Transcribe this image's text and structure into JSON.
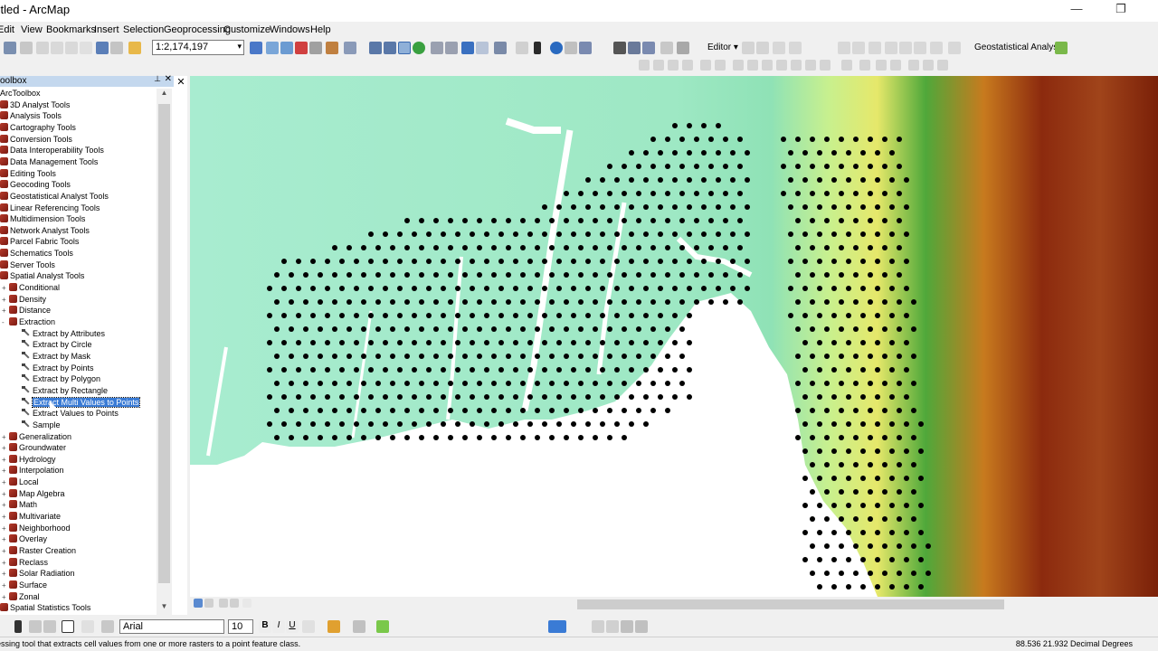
{
  "window": {
    "title": "titled - ArcMap",
    "minimize_glyph": "—",
    "restore_glyph": "❐"
  },
  "menu": [
    "Edit",
    "View",
    "Bookmarks",
    "Insert",
    "Selection",
    "Geoprocessing",
    "Customize",
    "Windows",
    "Help"
  ],
  "toolbar": {
    "scale": "1:2,174,197",
    "editor_label": "Editor ▾",
    "geostat_label": "Geostatistical Analyst ▾"
  },
  "toolbox": {
    "header": "oolbox",
    "root": "ArcToolbox",
    "items": [
      {
        "label": "3D Analyst Tools",
        "level": 0,
        "kind": "box"
      },
      {
        "label": "Analysis Tools",
        "level": 0,
        "kind": "box"
      },
      {
        "label": "Cartography Tools",
        "level": 0,
        "kind": "box"
      },
      {
        "label": "Conversion Tools",
        "level": 0,
        "kind": "box"
      },
      {
        "label": "Data Interoperability Tools",
        "level": 0,
        "kind": "box"
      },
      {
        "label": "Data Management Tools",
        "level": 0,
        "kind": "box"
      },
      {
        "label": "Editing Tools",
        "level": 0,
        "kind": "box"
      },
      {
        "label": "Geocoding Tools",
        "level": 0,
        "kind": "box"
      },
      {
        "label": "Geostatistical Analyst Tools",
        "level": 0,
        "kind": "box"
      },
      {
        "label": "Linear Referencing Tools",
        "level": 0,
        "kind": "box"
      },
      {
        "label": "Multidimension Tools",
        "level": 0,
        "kind": "box"
      },
      {
        "label": "Network Analyst Tools",
        "level": 0,
        "kind": "box"
      },
      {
        "label": "Parcel Fabric Tools",
        "level": 0,
        "kind": "box"
      },
      {
        "label": "Schematics Tools",
        "level": 0,
        "kind": "box"
      },
      {
        "label": "Server Tools",
        "level": 0,
        "kind": "box"
      },
      {
        "label": "Spatial Analyst Tools",
        "level": 0,
        "kind": "box"
      },
      {
        "label": "Conditional",
        "level": 1,
        "kind": "box",
        "exp": "+"
      },
      {
        "label": "Density",
        "level": 1,
        "kind": "box",
        "exp": "+"
      },
      {
        "label": "Distance",
        "level": 1,
        "kind": "box",
        "exp": "+"
      },
      {
        "label": "Extraction",
        "level": 1,
        "kind": "box",
        "exp": "−"
      },
      {
        "label": "Extract by Attributes",
        "level": 2,
        "kind": "tool"
      },
      {
        "label": "Extract by Circle",
        "level": 2,
        "kind": "tool"
      },
      {
        "label": "Extract by Mask",
        "level": 2,
        "kind": "tool"
      },
      {
        "label": "Extract by Points",
        "level": 2,
        "kind": "tool"
      },
      {
        "label": "Extract by Polygon",
        "level": 2,
        "kind": "tool"
      },
      {
        "label": "Extract by Rectangle",
        "level": 2,
        "kind": "tool"
      },
      {
        "label": "Extract Multi Values to Points",
        "level": 2,
        "kind": "tool",
        "selected": true
      },
      {
        "label": "Extract Values to Points",
        "level": 2,
        "kind": "tool"
      },
      {
        "label": "Sample",
        "level": 2,
        "kind": "tool"
      },
      {
        "label": "Generalization",
        "level": 1,
        "kind": "box",
        "exp": "+"
      },
      {
        "label": "Groundwater",
        "level": 1,
        "kind": "box",
        "exp": "+"
      },
      {
        "label": "Hydrology",
        "level": 1,
        "kind": "box",
        "exp": "+"
      },
      {
        "label": "Interpolation",
        "level": 1,
        "kind": "box",
        "exp": "+"
      },
      {
        "label": "Local",
        "level": 1,
        "kind": "box",
        "exp": "+"
      },
      {
        "label": "Map Algebra",
        "level": 1,
        "kind": "box",
        "exp": "+"
      },
      {
        "label": "Math",
        "level": 1,
        "kind": "box",
        "exp": "+"
      },
      {
        "label": "Multivariate",
        "level": 1,
        "kind": "box",
        "exp": "+"
      },
      {
        "label": "Neighborhood",
        "level": 1,
        "kind": "box",
        "exp": "+"
      },
      {
        "label": "Overlay",
        "level": 1,
        "kind": "box",
        "exp": "+"
      },
      {
        "label": "Raster Creation",
        "level": 1,
        "kind": "box",
        "exp": "+"
      },
      {
        "label": "Reclass",
        "level": 1,
        "kind": "box",
        "exp": "+"
      },
      {
        "label": "Solar Radiation",
        "level": 1,
        "kind": "box",
        "exp": "+"
      },
      {
        "label": "Surface",
        "level": 1,
        "kind": "box",
        "exp": "+"
      },
      {
        "label": "Zonal",
        "level": 1,
        "kind": "box",
        "exp": "+"
      },
      {
        "label": "Spatial Statistics Tools",
        "level": 0,
        "kind": "box"
      }
    ]
  },
  "drawing": {
    "font_name": "Arial",
    "font_size": "10"
  },
  "status": {
    "message": "essing tool that extracts cell values from one or more rasters to a point feature class.",
    "coordinates": "88.536  21.932 Decimal Degrees"
  },
  "colors": {
    "selection": "#3a7bd5",
    "sea": "#a8ecd0",
    "lowland": "#7fe0b4",
    "upland": "#d8f08c",
    "hills": "#6fb84a",
    "peaks": "#8c2a0e"
  }
}
